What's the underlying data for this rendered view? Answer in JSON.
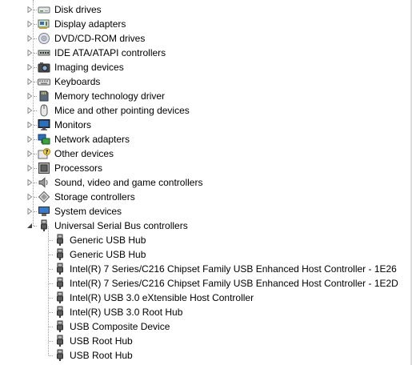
{
  "tree": {
    "categories": [
      {
        "label": "Disk drives",
        "icon": "disk-drive-icon",
        "expanded": false
      },
      {
        "label": "Display adapters",
        "icon": "display-adapter-icon",
        "expanded": false
      },
      {
        "label": "DVD/CD-ROM drives",
        "icon": "dvd-drive-icon",
        "expanded": false
      },
      {
        "label": "IDE ATA/ATAPI controllers",
        "icon": "ide-controller-icon",
        "expanded": false
      },
      {
        "label": "Imaging devices",
        "icon": "imaging-device-icon",
        "expanded": false
      },
      {
        "label": "Keyboards",
        "icon": "keyboard-icon",
        "expanded": false
      },
      {
        "label": "Memory technology driver",
        "icon": "memory-card-icon",
        "expanded": false
      },
      {
        "label": "Mice and other pointing devices",
        "icon": "mouse-icon",
        "expanded": false
      },
      {
        "label": "Monitors",
        "icon": "monitor-icon",
        "expanded": false
      },
      {
        "label": "Network adapters",
        "icon": "network-adapter-icon",
        "expanded": false
      },
      {
        "label": "Other devices",
        "icon": "unknown-device-icon",
        "expanded": false
      },
      {
        "label": "Processors",
        "icon": "processor-icon",
        "expanded": false
      },
      {
        "label": "Sound, video and game controllers",
        "icon": "speaker-icon",
        "expanded": false
      },
      {
        "label": "Storage controllers",
        "icon": "storage-controller-icon",
        "expanded": false
      },
      {
        "label": "System devices",
        "icon": "system-device-icon",
        "expanded": false
      },
      {
        "label": "Universal Serial Bus controllers",
        "icon": "usb-plug-icon",
        "expanded": true
      }
    ],
    "usb_devices": [
      {
        "label": "Generic USB Hub",
        "icon": "usb-plug-icon"
      },
      {
        "label": "Generic USB Hub",
        "icon": "usb-plug-icon"
      },
      {
        "label": "Intel(R) 7 Series/C216 Chipset Family USB Enhanced Host Controller - 1E26",
        "icon": "usb-plug-icon"
      },
      {
        "label": "Intel(R) 7 Series/C216 Chipset Family USB Enhanced Host Controller - 1E2D",
        "icon": "usb-plug-icon"
      },
      {
        "label": "Intel(R) USB 3.0 eXtensible Host Controller",
        "icon": "usb-plug-icon"
      },
      {
        "label": "Intel(R) USB 3.0 Root Hub",
        "icon": "usb-plug-icon"
      },
      {
        "label": "USB Composite Device",
        "icon": "usb-plug-icon"
      },
      {
        "label": "USB Root Hub",
        "icon": "usb-plug-icon"
      },
      {
        "label": "USB Root Hub",
        "icon": "usb-plug-icon"
      }
    ]
  },
  "colors": {
    "expander": "#8a8a8a",
    "tree_line": "#a0a0a0",
    "usb_icon": "#4a4a4a"
  }
}
